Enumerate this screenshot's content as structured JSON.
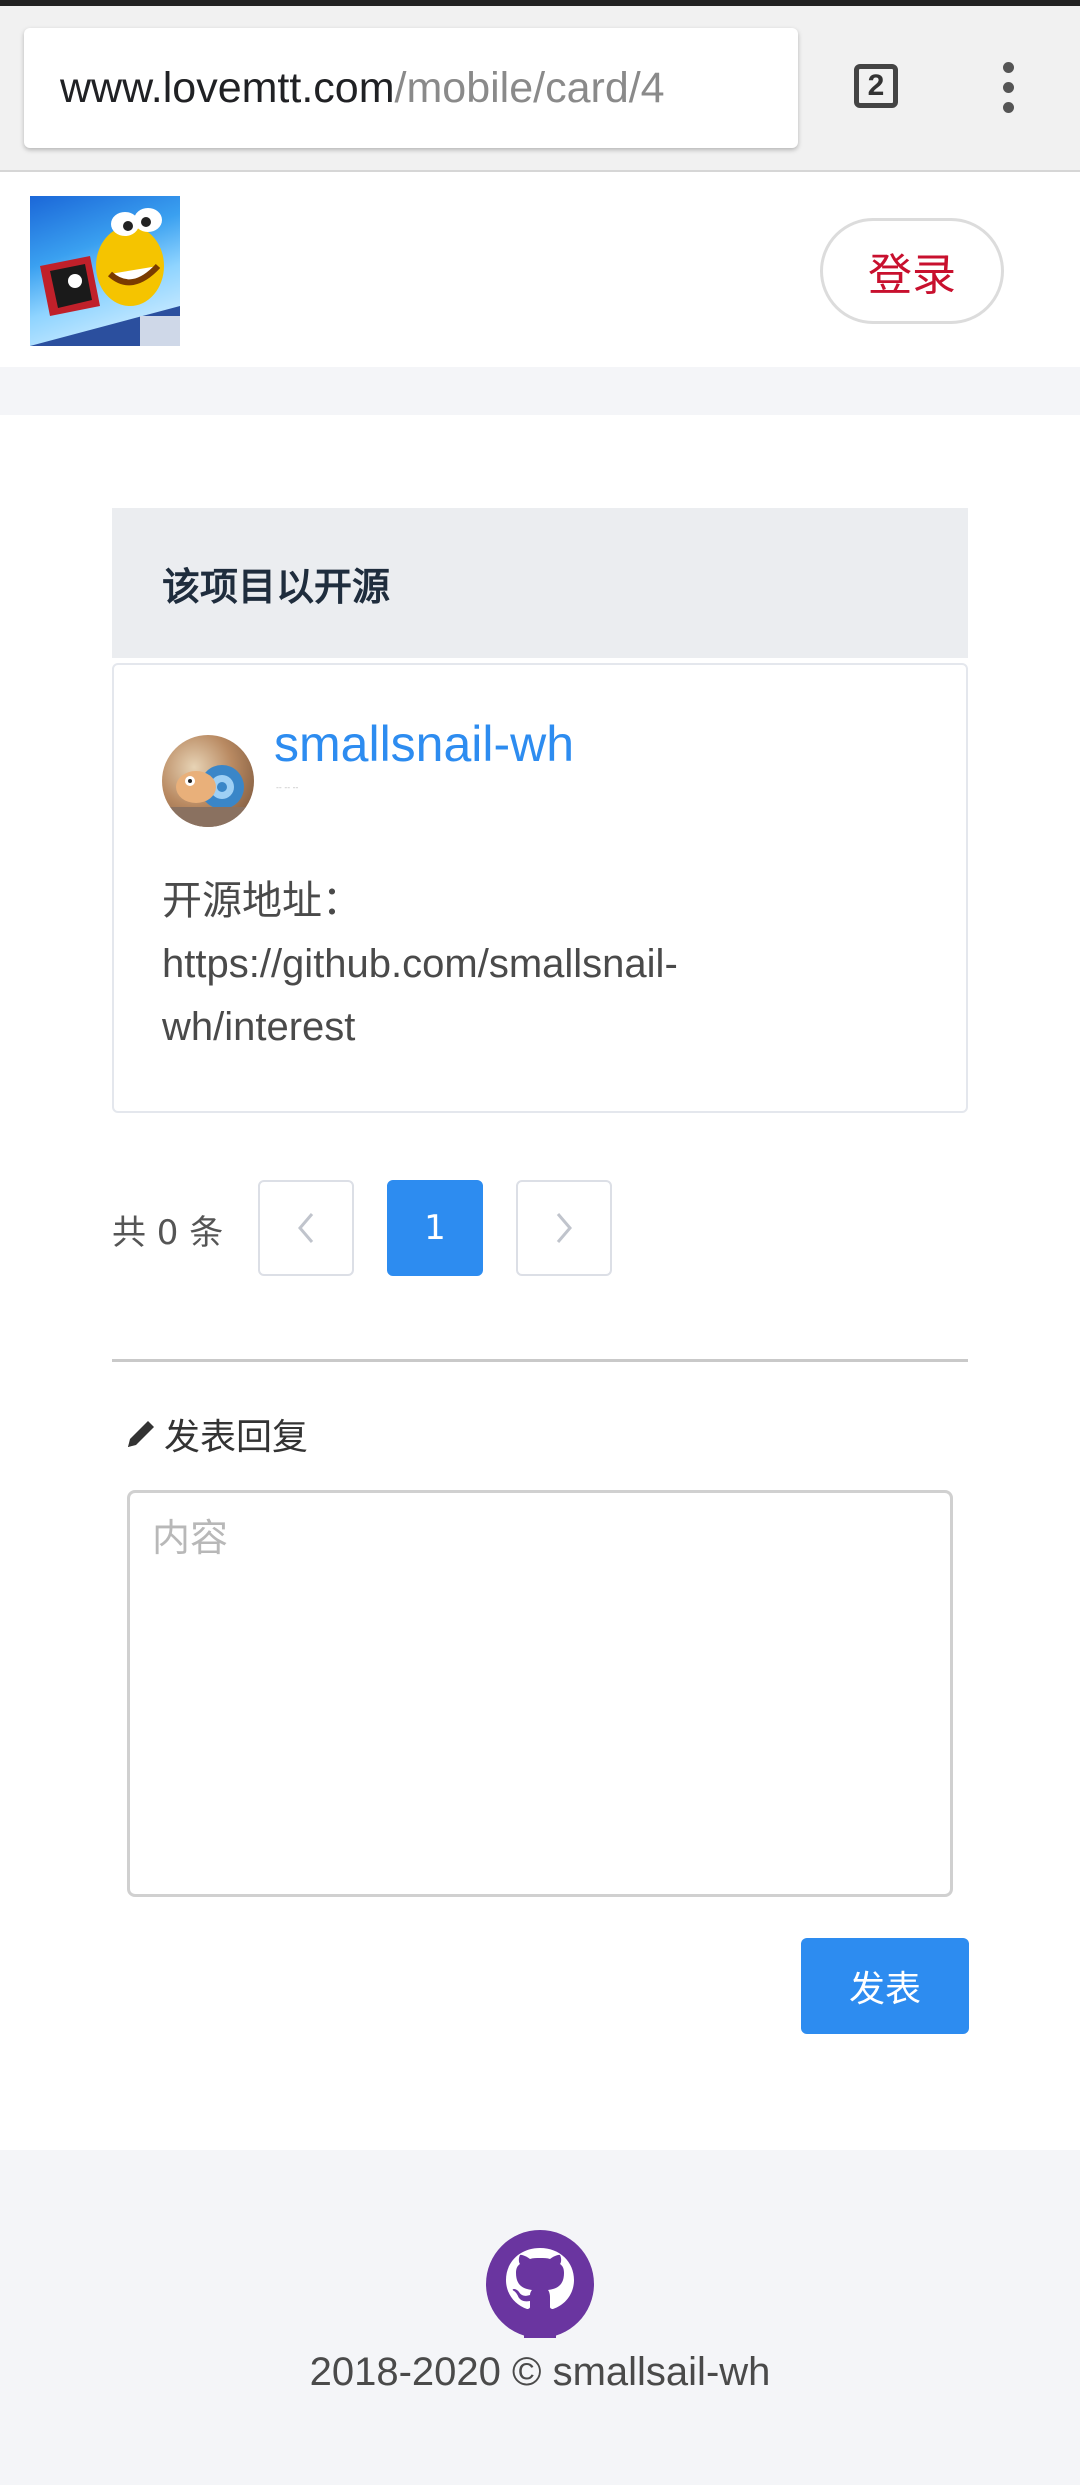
{
  "browser": {
    "url_host": "www.lovemtt.com",
    "url_path": "/mobile/card/4",
    "tab_count": "2",
    "menu_icon": "more-vert-icon"
  },
  "header": {
    "logo_icon": "snail-logo",
    "login_label": "登录"
  },
  "card": {
    "title": "该项目以开源",
    "author_name": "smallsnail-wh",
    "author_sub": "-- -- --",
    "content_line1": "开源地址：",
    "content_line2": "https://github.com/smallsnail-",
    "content_line3": "wh/interest"
  },
  "pagination": {
    "total_label": "共 0 条",
    "prev_icon": "chevron-left-icon",
    "current_page": "1",
    "next_icon": "chevron-right-icon"
  },
  "reply": {
    "title": "发表回复",
    "title_icon": "pencil-icon",
    "placeholder": "内容",
    "submit_label": "发表"
  },
  "footer": {
    "icon": "github-icon",
    "copyright": "2018-2020 © smallsail-wh"
  },
  "colors": {
    "accent": "#2d8cf0",
    "login_text": "#c8102e",
    "github_purple": "#6a35a0"
  }
}
